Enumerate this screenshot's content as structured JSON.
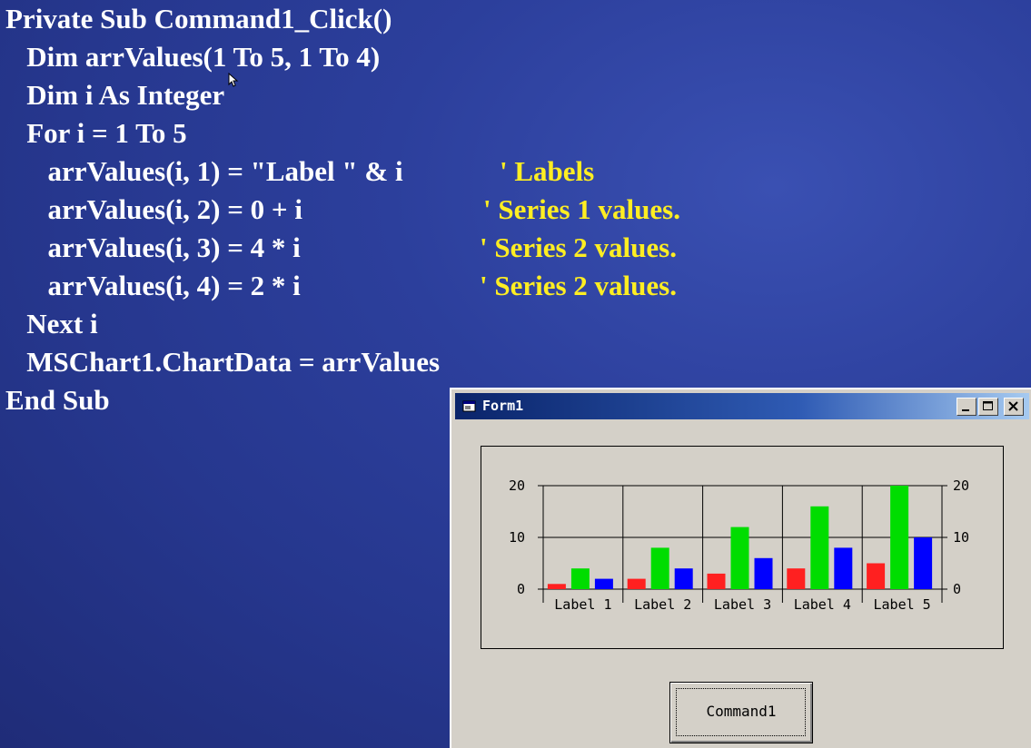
{
  "code": {
    "lines": [
      {
        "text": "Private Sub Command1_Click()",
        "comment": ""
      },
      {
        "text": "   Dim arrValues(1 To 5, 1 To 4)",
        "comment": ""
      },
      {
        "text": "   Dim i As Integer",
        "comment": ""
      },
      {
        "text": "   For i = 1 To 5",
        "comment": ""
      },
      {
        "text": "      arrValues(i, 1) = \"Label \" & i",
        "comment": "' Labels"
      },
      {
        "text": "      arrValues(i, 2) = 0 + i",
        "comment": "' Series 1 values."
      },
      {
        "text": "      arrValues(i, 3) = 4 * i",
        "comment": "' Series 2 values."
      },
      {
        "text": "      arrValues(i, 4) = 2 * i",
        "comment": "' Series 2 values."
      },
      {
        "text": "   Next i",
        "comment": ""
      },
      {
        "text": "   MSChart1.ChartData = arrValues",
        "comment": ""
      },
      {
        "text": "End Sub",
        "comment": ""
      }
    ]
  },
  "form": {
    "title": "Form1",
    "command_label": "Command1"
  },
  "colors": {
    "code_text": "#ffffff",
    "comment_text": "#ffee22",
    "series": [
      "#ff2020",
      "#00dd00",
      "#0000ff"
    ]
  },
  "chart_data": {
    "type": "bar",
    "categories": [
      "Label 1",
      "Label 2",
      "Label 3",
      "Label 4",
      "Label 5"
    ],
    "series": [
      {
        "values": [
          1,
          2,
          3,
          4,
          5
        ]
      },
      {
        "values": [
          4,
          8,
          12,
          16,
          20
        ]
      },
      {
        "values": [
          2,
          4,
          6,
          8,
          10
        ]
      }
    ],
    "y_ticks": [
      "0",
      "10",
      "20"
    ],
    "ylim": [
      0,
      20
    ],
    "grid": true,
    "legend": "none"
  }
}
